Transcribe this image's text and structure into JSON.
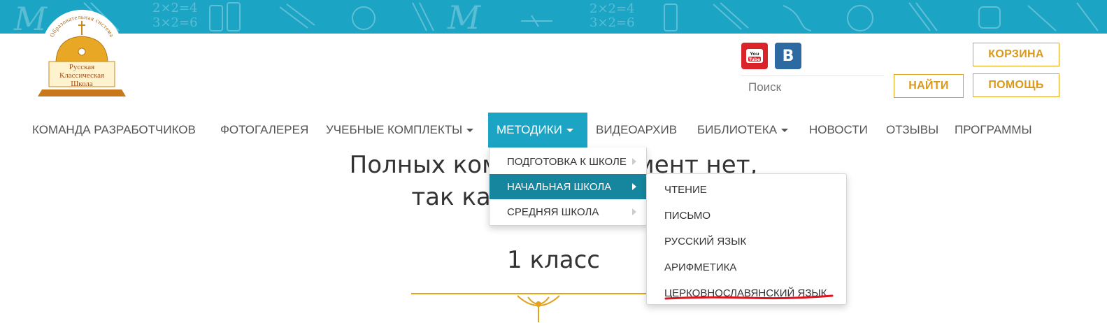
{
  "logo": {
    "ring_text": "Образовательная система",
    "line1": "Русская",
    "line2": "Классическая",
    "line3": "Школа"
  },
  "header": {
    "search_placeholder": "Поиск",
    "find_label": "НАЙТИ",
    "cart_label": "КОРЗИНА",
    "help_label": "ПОМОЩЬ",
    "youtube_label": "YouTube",
    "vk_label": "B"
  },
  "nav": {
    "items": [
      {
        "label": "КОМАНДА РАЗРАБОТЧИКОВ"
      },
      {
        "label": "ФОТОГАЛЕРЕЯ"
      },
      {
        "label": "УЧЕБНЫЕ КОМПЛЕКТЫ"
      },
      {
        "label": "МЕТОДИКИ"
      },
      {
        "label": "ВИДЕОАРХИВ"
      },
      {
        "label": "БИБЛИОТЕКА"
      },
      {
        "label": "НОВОСТИ"
      },
      {
        "label": "ОТЗЫВЫ"
      },
      {
        "label": "ПРОГРАММЫ"
      }
    ]
  },
  "dropdown": {
    "items": [
      {
        "label": "ПОДГОТОВКА К ШКОЛЕ"
      },
      {
        "label": "НАЧАЛЬНАЯ ШКОЛА"
      },
      {
        "label": "СРЕДНЯЯ ШКОЛА"
      }
    ]
  },
  "submenu": {
    "items": [
      {
        "label": "ЧТЕНИЕ"
      },
      {
        "label": "ПИСЬМО"
      },
      {
        "label": "РУССКИЙ ЯЗЫК"
      },
      {
        "label": "АРИФМЕТИКА"
      },
      {
        "label": "ЦЕРКОВНОСЛАВЯНСКИЙ ЯЗЫК"
      }
    ]
  },
  "main": {
    "heading_line1": "Полных комплект                й момент нет,",
    "heading_line2": "так как не все учебн                                         и",
    "grade": "1 класс"
  },
  "banner_deco": [
    "2×2=4",
    "3×2=6",
    "M",
    "2×2=4",
    "3×2=6",
    "M"
  ],
  "colors": {
    "accent": "#1ba4c4",
    "active_submenu": "#16869f",
    "gold": "#e2a31c",
    "youtube": "#d9252a",
    "vk": "#2d6aa2",
    "annotation": "#e0141e"
  }
}
